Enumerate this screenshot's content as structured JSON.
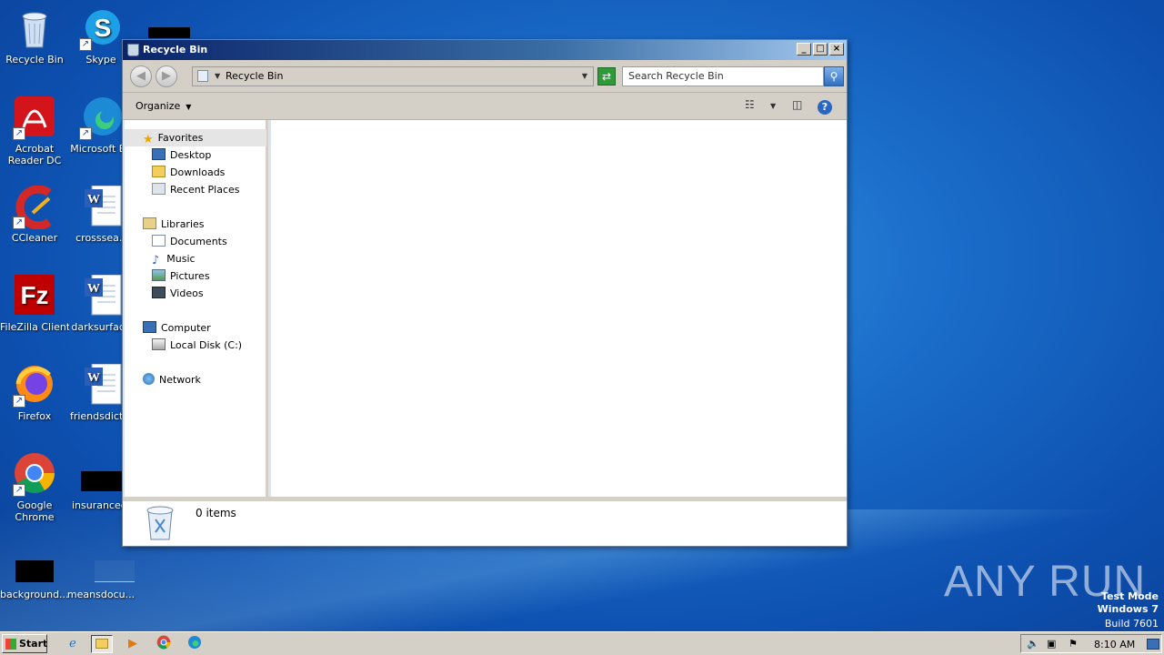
{
  "desktop": {
    "icons": [
      {
        "label": "Recycle Bin",
        "icon": "recycle-bin-icon"
      },
      {
        "label": "Skype",
        "icon": "skype-icon"
      },
      {
        "label": "Acrobat Reader DC",
        "line1": "Acrobat",
        "line2": "Reader DC",
        "icon": "acrobat-icon"
      },
      {
        "label": "Microsoft Ed",
        "icon": "edge-icon"
      },
      {
        "label": "CCleaner",
        "icon": "ccleaner-icon"
      },
      {
        "label": "crosssea.r",
        "icon": "word-doc-icon"
      },
      {
        "label": "FileZilla Client",
        "icon": "filezilla-icon"
      },
      {
        "label": "darksurface",
        "icon": "word-doc-icon"
      },
      {
        "label": "Firefox",
        "icon": "firefox-icon"
      },
      {
        "label": "friendsdictio",
        "icon": "word-doc-icon"
      },
      {
        "label": "Google Chrome",
        "line1": "Google",
        "line2": "Chrome",
        "icon": "chrome-icon"
      },
      {
        "label": "insurancee.",
        "icon": "file-icon"
      },
      {
        "label": "background....",
        "icon": "file-icon"
      },
      {
        "label": "meansdocu...",
        "icon": "file-icon"
      }
    ],
    "watermark": {
      "line1": "Test Mode",
      "line2": "Windows 7",
      "line3": "Build 7601"
    },
    "brand": "ANY RUN"
  },
  "window": {
    "title": "Recycle Bin",
    "address": "Recycle Bin",
    "search_placeholder": "Search Recycle Bin",
    "organize_label": "Organize",
    "nav": {
      "favorites": "Favorites",
      "desktop": "Desktop",
      "downloads": "Downloads",
      "recent": "Recent Places",
      "libraries": "Libraries",
      "documents": "Documents",
      "music": "Music",
      "pictures": "Pictures",
      "videos": "Videos",
      "computer": "Computer",
      "local_disk": "Local Disk (C:)",
      "network": "Network"
    },
    "details": {
      "count": "0 items"
    }
  },
  "taskbar": {
    "start_label": "Start",
    "clock": "8:10 AM"
  },
  "colors": {
    "desktop_blue": "#1a6cc9",
    "title_gradient_start": "#0a246a",
    "selected_nav": "#e5e5e5"
  }
}
